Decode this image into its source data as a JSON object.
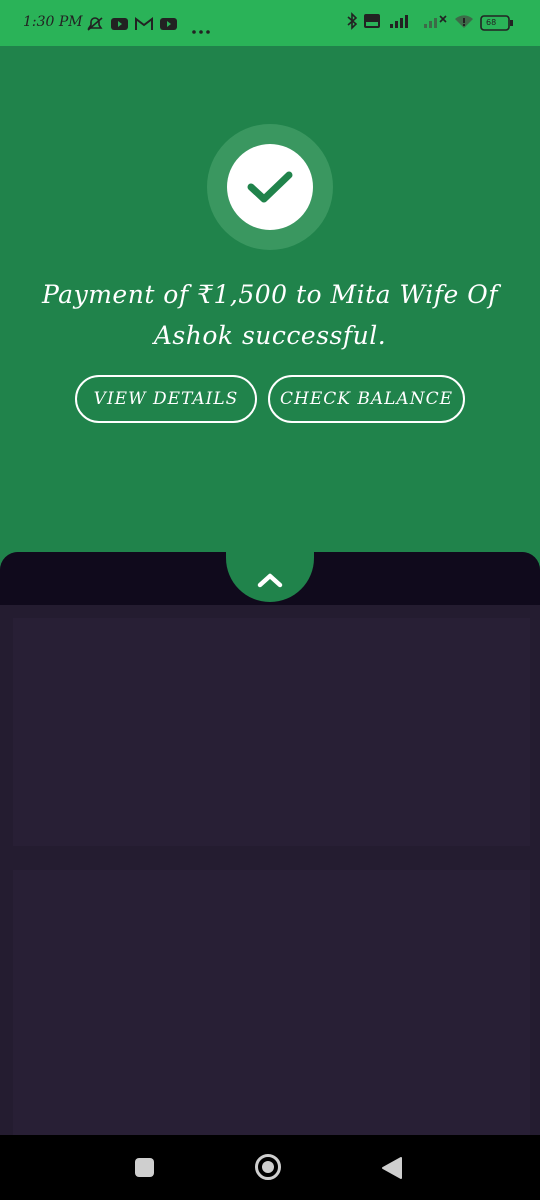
{
  "status_bar": {
    "time": "1:30 PM",
    "battery_label": "68",
    "icons": [
      "alarm-off-icon",
      "youtube-icon",
      "gmail-icon",
      "youtube-icon",
      "more-dots-icon",
      "bluetooth-icon",
      "volte-icon",
      "signal-icon",
      "signal-icon",
      "wifi-icon",
      "battery-icon"
    ]
  },
  "success": {
    "message": "Payment of ₹1,500 to Mita Wife Of Ashok successful.",
    "view_details_label": "VIEW DETAILS",
    "check_balance_label": "CHECK BALANCE"
  },
  "colors": {
    "status_bar": "#2ab358",
    "panel_green": "#20834b",
    "sheet_bg": "#241c30",
    "sheet_header": "#100a1c"
  },
  "bottom_sheet": {
    "handle_icon": "chevron-up-icon"
  },
  "nav_bar": {
    "icons": [
      "recents-icon",
      "home-icon",
      "back-icon"
    ]
  }
}
